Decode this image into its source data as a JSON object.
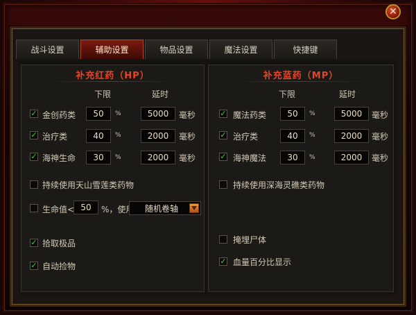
{
  "window": {
    "close_glyph": "✕"
  },
  "tabs": [
    {
      "label": "战斗设置"
    },
    {
      "label": "辅助设置"
    },
    {
      "label": "物品设置"
    },
    {
      "label": "魔法设置"
    },
    {
      "label": "快捷键"
    }
  ],
  "active_tab": 1,
  "left_panel": {
    "title": "补充红药（HP）",
    "col_lower": "下限",
    "col_delay": "延时",
    "rows": [
      {
        "label": "金创药类",
        "checked": true,
        "lower": "50",
        "percent": "%",
        "delay": "5000",
        "unit": "毫秒"
      },
      {
        "label": "治疗类",
        "checked": true,
        "lower": "40",
        "percent": "%",
        "delay": "2000",
        "unit": "毫秒"
      },
      {
        "label": "海神生命",
        "checked": true,
        "lower": "30",
        "percent": "%",
        "delay": "2000",
        "unit": "毫秒"
      }
    ],
    "continuous_label": "持续使用天山雪莲类药物",
    "continuous_checked": false,
    "hp_use": {
      "prefix": "生命值<",
      "value": "50",
      "suffix": "%，使用",
      "select_value": "随机卷轴",
      "checked": false
    },
    "pick_best_label": "拾取极品",
    "pick_best_checked": true,
    "auto_pick_label": "自动捡物",
    "auto_pick_checked": true
  },
  "right_panel": {
    "title": "补充蓝药（MP）",
    "col_lower": "下限",
    "col_delay": "延时",
    "rows": [
      {
        "label": "魔法药类",
        "checked": true,
        "lower": "50",
        "percent": "%",
        "delay": "5000",
        "unit": "毫秒"
      },
      {
        "label": "治疗类",
        "checked": true,
        "lower": "40",
        "percent": "%",
        "delay": "2000",
        "unit": "毫秒"
      },
      {
        "label": "海神魔法",
        "checked": true,
        "lower": "30",
        "percent": "%",
        "delay": "2000",
        "unit": "毫秒"
      }
    ],
    "continuous_label": "持续使用深海灵礁类药物",
    "continuous_checked": false,
    "corpse_label": "掩埋尸体",
    "corpse_checked": false,
    "hp_percent_label": "血量百分比显示",
    "hp_percent_checked": true
  },
  "colors": {
    "accent_red": "#e0462a",
    "check_green": "#3fd23f",
    "tab_active": "#7a1a10"
  }
}
